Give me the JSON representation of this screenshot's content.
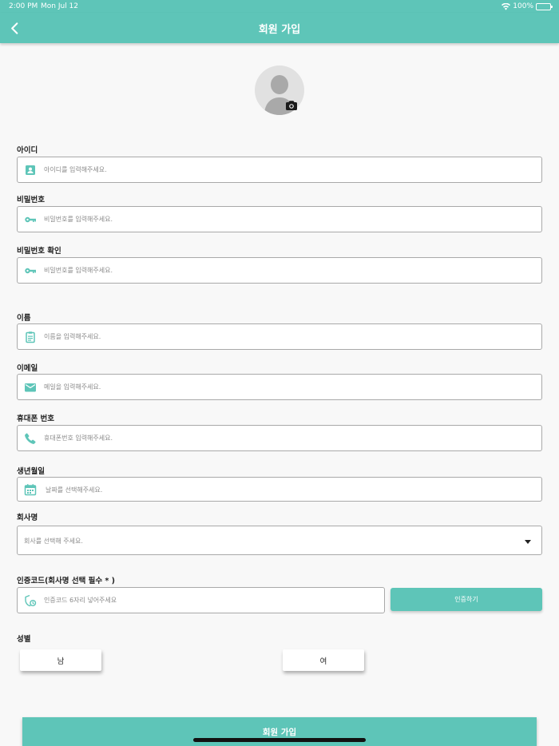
{
  "status_bar": {
    "time": "2:00 PM",
    "date": "Mon Jul 12",
    "battery": "100%"
  },
  "nav": {
    "title": "회원 가입"
  },
  "form": {
    "id": {
      "label": "아이디",
      "placeholder": "아이디를 입력해주세요.",
      "icon": "person-icon"
    },
    "password": {
      "label": "비밀번호",
      "placeholder": "비밀번호를 입력해주세요.",
      "icon": "key-icon"
    },
    "password_confirm": {
      "label": "비밀번호 확인",
      "placeholder": "비밀번호를 입력해주세요.",
      "icon": "key-icon"
    },
    "name": {
      "label": "이름",
      "placeholder": "이름을 입력해주세요.",
      "icon": "clipboard-icon"
    },
    "email": {
      "label": "이메일",
      "placeholder": "메일을 입력해주세요.",
      "icon": "mail-icon"
    },
    "phone": {
      "label": "휴대폰 번호",
      "placeholder": "휴대폰번호 입력해주세요.",
      "icon": "phone-icon"
    },
    "birthdate": {
      "label": "생년월일",
      "placeholder": "날짜를 선택해주세요.",
      "icon": "calendar-icon"
    },
    "company": {
      "label": "회사명",
      "placeholder": "회사를 선택해 주세요."
    },
    "auth_code": {
      "label": "인증코드(회사명 선택 필수 * )",
      "placeholder": "인증코드 6자리 넣어주세요",
      "button": "인증하기",
      "icon": "shield-icon"
    },
    "gender": {
      "label": "성별",
      "male": "남",
      "female": "여"
    }
  },
  "submit_label": "회원 가입",
  "colors": {
    "accent": "#5ec5b8",
    "border": "#a9a9a9",
    "background": "#f8f8f8"
  }
}
